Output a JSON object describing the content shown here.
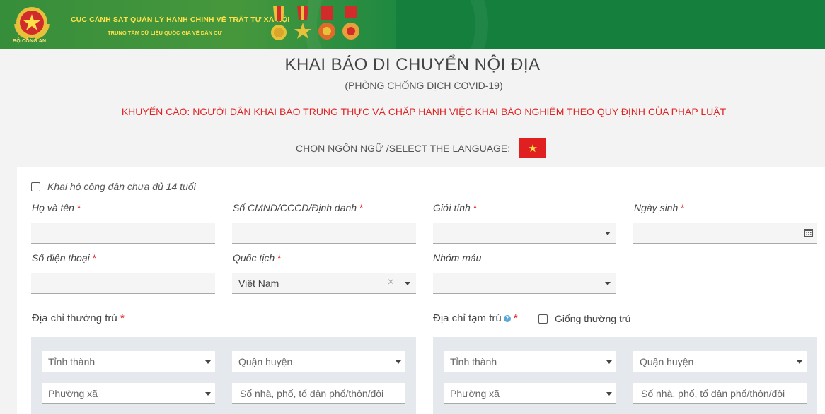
{
  "header": {
    "logo_caption": "BỘ CÔNG AN",
    "org_title": "CỤC CẢNH SÁT QUẢN LÝ HÀNH CHÍNH VỀ TRẬT TỰ XÃ HỘI",
    "org_subtitle": "TRUNG TÂM DỮ LIỆU QUỐC GIA VỀ DÂN CƯ",
    "colors": {
      "bar": "#15803e",
      "text": "#ffe14a"
    }
  },
  "page": {
    "title": "KHAI BÁO DI CHUYỂN NỘI ĐỊA",
    "subtitle": "(PHÒNG CHỐNG DỊCH COVID-19)",
    "warning": "KHUYẾN CÁO: NGƯỜI DÂN KHAI BÁO TRUNG THỰC VÀ CHẤP HÀNH VIỆC KHAI BÁO NGHIÊM THEO QUY ĐỊNH CỦA PHÁP LUẬT",
    "language_label": "CHỌN NGÔN NGỮ /SELECT THE LANGUAGE:",
    "language_flag": "vietnam-flag-icon"
  },
  "form": {
    "proxy_checkbox_label": "Khai hộ công dân chưa đủ 14 tuổi",
    "required_mark": "*",
    "full_name_label": "Họ và tên",
    "id_number_label": "Số CMND/CCCD/Định danh",
    "gender_label": "Giới tính",
    "dob_label": "Ngày sinh",
    "phone_label": "Số điện thoại",
    "nationality_label": "Quốc tịch",
    "nationality_value": "Việt Nam",
    "blood_type_label": "Nhóm máu",
    "permanent_address_label": "Địa chỉ thường trú",
    "temporary_address_label": "Địa chỉ tạm trú",
    "same_as_permanent_label": "Giống thường trú",
    "province_placeholder": "Tỉnh thành",
    "district_placeholder": "Quận huyện",
    "ward_placeholder": "Phường xã",
    "street_placeholder": "Số nhà, phố, tổ dân phố/thôn/đội"
  }
}
